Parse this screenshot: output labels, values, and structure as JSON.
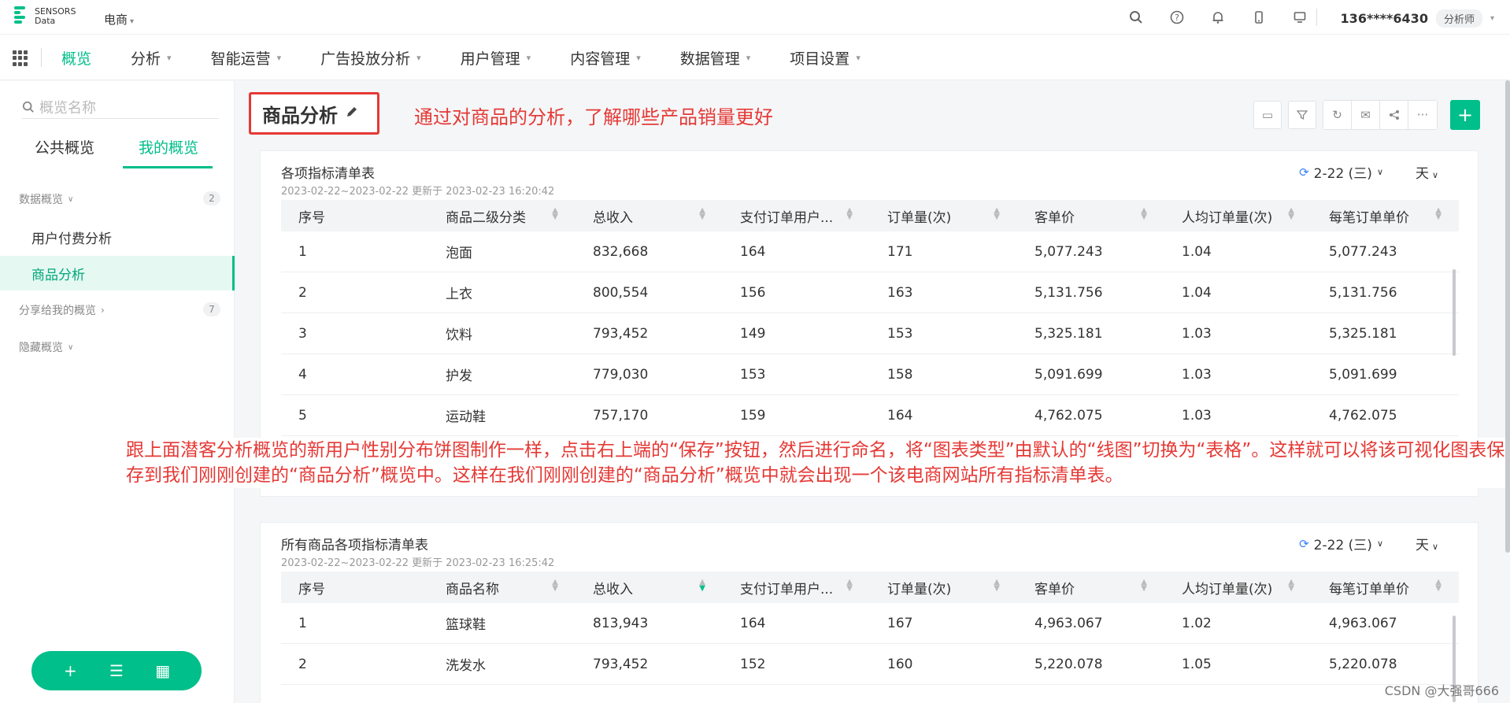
{
  "brand": {
    "line1": "SENSORS",
    "line2": "Data"
  },
  "project": {
    "name": "电商"
  },
  "header": {
    "user_phone": "136****6430",
    "user_role": "分析师"
  },
  "nav": {
    "items": [
      {
        "label": "概览",
        "active": true,
        "caret": false
      },
      {
        "label": "分析",
        "active": false,
        "caret": true
      },
      {
        "label": "智能运营",
        "active": false,
        "caret": true
      },
      {
        "label": "广告投放分析",
        "active": false,
        "caret": true
      },
      {
        "label": "用户管理",
        "active": false,
        "caret": true
      },
      {
        "label": "内容管理",
        "active": false,
        "caret": true
      },
      {
        "label": "数据管理",
        "active": false,
        "caret": true
      },
      {
        "label": "项目设置",
        "active": false,
        "caret": true
      }
    ]
  },
  "sidebar": {
    "search_placeholder": "概览名称",
    "tab_public": "公共概览",
    "tab_mine": "我的概览",
    "group_data": "数据概览",
    "group_data_count": "2",
    "items": [
      "用户付费分析",
      "商品分析"
    ],
    "group_shared": "分享给我的概览",
    "group_shared_count": "7",
    "group_hidden": "隐藏概览"
  },
  "page": {
    "title": "商品分析",
    "note_top": "通过对商品的分析，了解哪些产品销量更好",
    "note_big": "跟上面潜客分析概览的新用户性别分布饼图制作一样，点击右上端的“保存”按钮，然后进行命名，将“图表类型”由默认的“线图”切换为“表格”。这样就可以将该可视化图表保存到我们刚刚创建的“商品分析”概览中。这样在我们刚刚创建的“商品分析”概览中就会出现一个该电商网站所有指标清单表。"
  },
  "card1": {
    "title": "各项指标清单表",
    "subtitle": "2023-02-22~2023-02-22 更新于 2023-02-23 16:20:42",
    "date": "2-22 (三)",
    "unit": "天",
    "headers": [
      "序号",
      "商品二级分类",
      "总收入",
      "支付订单用户...",
      "订单量(次)",
      "客单价",
      "人均订单量(次)",
      "每笔订单单价"
    ],
    "rows": [
      [
        "1",
        "泡面",
        "832,668",
        "164",
        "171",
        "5,077.243",
        "1.04",
        "5,077.243"
      ],
      [
        "2",
        "上衣",
        "800,554",
        "156",
        "163",
        "5,131.756",
        "1.04",
        "5,131.756"
      ],
      [
        "3",
        "饮料",
        "793,452",
        "149",
        "153",
        "5,325.181",
        "1.03",
        "5,325.181"
      ],
      [
        "4",
        "护发",
        "779,030",
        "153",
        "158",
        "5,091.699",
        "1.03",
        "5,091.699"
      ],
      [
        "5",
        "运动鞋",
        "757,170",
        "159",
        "164",
        "4,762.075",
        "1.03",
        "4,762.075"
      ]
    ]
  },
  "card2": {
    "title": "所有商品各项指标清单表",
    "subtitle": "2023-02-22~2023-02-22 更新于 2023-02-23 16:25:42",
    "date": "2-22 (三)",
    "unit": "天",
    "headers": [
      "序号",
      "商品名称",
      "总收入",
      "支付订单用户...",
      "订单量(次)",
      "客单价",
      "人均订单量(次)",
      "每笔订单单价"
    ],
    "rows": [
      [
        "1",
        "篮球鞋",
        "813,943",
        "164",
        "167",
        "4,963.067",
        "1.02",
        "4,963.067"
      ],
      [
        "2",
        "洗发水",
        "793,452",
        "152",
        "160",
        "5,220.078",
        "1.05",
        "5,220.078"
      ]
    ]
  },
  "watermark": "CSDN @大强哥666",
  "colors": {
    "accent": "#00bf8a",
    "annotation": "#e53935"
  }
}
